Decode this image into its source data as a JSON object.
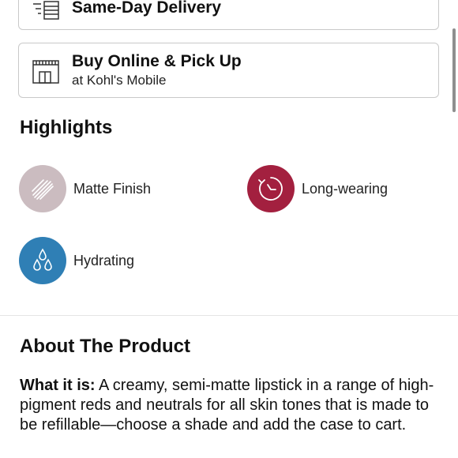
{
  "fulfillment": {
    "delivery": {
      "title": "Same-Day Delivery",
      "icon": "delivery-truck-icon"
    },
    "pickup": {
      "title": "Buy Online & Pick Up",
      "subtitle": "at Kohl's Mobile",
      "icon": "store-icon"
    }
  },
  "highlights": {
    "heading": "Highlights",
    "items": [
      {
        "label": "Matte Finish",
        "icon": "matte-texture-icon",
        "color": "#cbbcc0"
      },
      {
        "label": "Long-wearing",
        "icon": "timer-icon",
        "color": "#a3203f"
      },
      {
        "label": "Hydrating",
        "icon": "water-drops-icon",
        "color": "#2f7fb5"
      }
    ]
  },
  "about": {
    "heading": "About The Product",
    "lead": "What it is:",
    "text": " A creamy, semi-matte lipstick in a range of high-pigment reds and neutrals for all skin tones that is made to be refillable—choose a shade and add the case to cart."
  },
  "colors": {
    "text": "#111111",
    "border": "#c9c9c9",
    "divider": "#e4e4e4"
  }
}
